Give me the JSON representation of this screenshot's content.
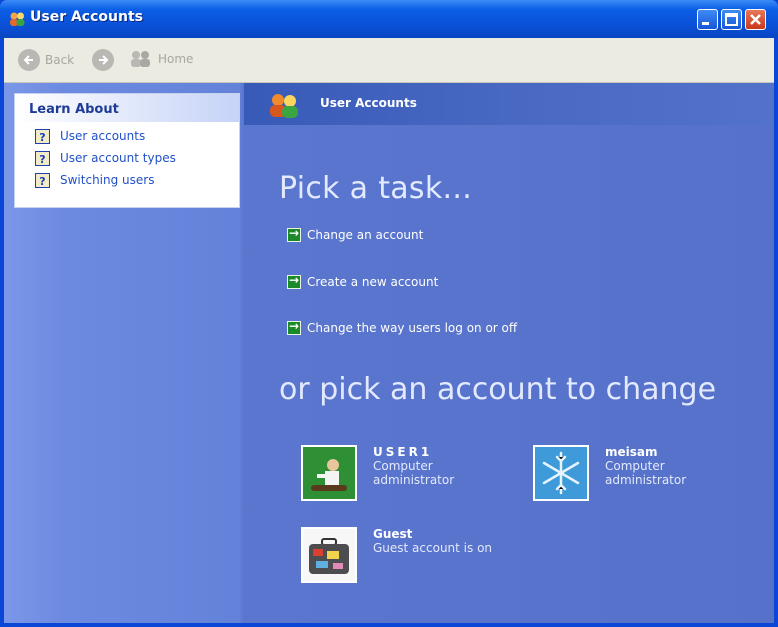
{
  "window": {
    "title": "User Accounts",
    "colors": {
      "titlebar": "#0a4fd6",
      "content": "#5a76ce",
      "close": "#c9371b"
    }
  },
  "toolbar": {
    "back_label": "Back",
    "home_label": "Home"
  },
  "learn_about": {
    "heading": "Learn About",
    "items": [
      {
        "label": "User accounts",
        "icon": "help-icon"
      },
      {
        "label": "User account types",
        "icon": "help-icon"
      },
      {
        "label": "Switching users",
        "icon": "help-icon"
      }
    ]
  },
  "main": {
    "header_title": "User Accounts",
    "pick_task_heading": "Pick a task...",
    "tasks": [
      {
        "label": "Change an account",
        "icon": "green-arrow-icon"
      },
      {
        "label": "Create a new account",
        "icon": "green-arrow-icon"
      },
      {
        "label": "Change the way users log on or off",
        "icon": "green-arrow-icon"
      }
    ],
    "pick_account_heading": "or pick an account to change",
    "accounts": [
      {
        "name": "USER1",
        "type_line1": "Computer",
        "type_line2": "administrator",
        "icon": "skateboarder-avatar"
      },
      {
        "name": "meisam",
        "type_line1": "Computer",
        "type_line2": "administrator",
        "icon": "snowflake-avatar"
      },
      {
        "name": "Guest",
        "type_line1": "Guest account is on",
        "type_line2": "",
        "icon": "suitcase-avatar"
      }
    ]
  }
}
